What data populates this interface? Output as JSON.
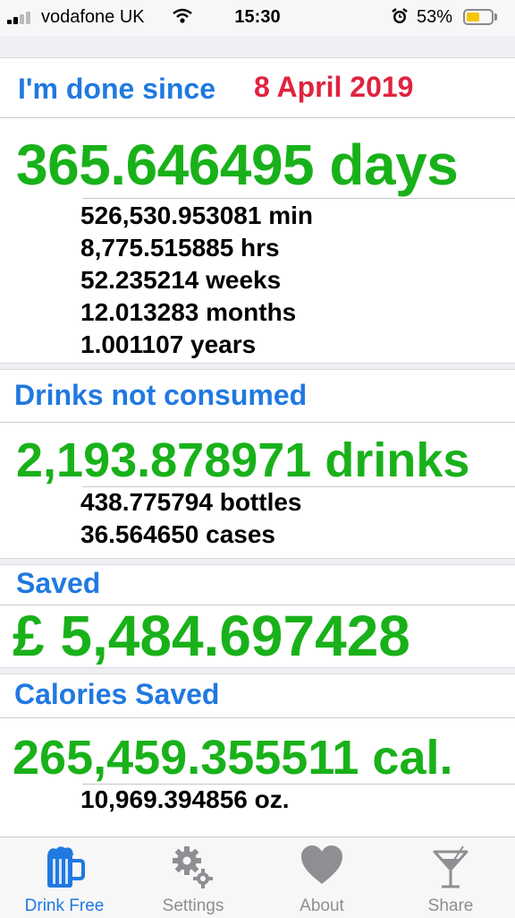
{
  "status_bar": {
    "carrier": "vodafone UK",
    "time": "15:30",
    "battery_percent": "53%",
    "battery_level": 0.53,
    "icons": [
      "signal-icon",
      "wifi-icon",
      "alarm-icon",
      "battery-icon"
    ]
  },
  "sobriety": {
    "heading": "I'm done since",
    "date": "8 April 2019",
    "days": "365.646495 days",
    "breakdown": [
      "526,530.953081 min",
      "8,775.515885 hrs",
      "52.235214 weeks",
      "12.013283 months",
      "1.001107 years"
    ]
  },
  "drinks": {
    "heading": "Drinks not consumed",
    "total": "2,193.878971 drinks",
    "breakdown": [
      "438.775794 bottles",
      "36.564650 cases"
    ]
  },
  "saved": {
    "heading": "Saved",
    "amount": "£ 5,484.697428"
  },
  "calories": {
    "heading": "Calories Saved",
    "total": "265,459.355511 cal.",
    "breakdown": [
      "10,969.394856 oz."
    ]
  },
  "tabbar": {
    "tabs": [
      {
        "label": "Drink Free",
        "icon": "beer-mug-icon",
        "active": true
      },
      {
        "label": "Settings",
        "icon": "gears-icon",
        "active": false
      },
      {
        "label": "About",
        "icon": "heart-icon",
        "active": false
      },
      {
        "label": "Share",
        "icon": "cocktail-glass-icon",
        "active": false
      }
    ]
  },
  "colors": {
    "accent_blue": "#2079e0",
    "highlight_red": "#e0233f",
    "value_green": "#19b11a",
    "battery_yellow": "#f5c400"
  }
}
